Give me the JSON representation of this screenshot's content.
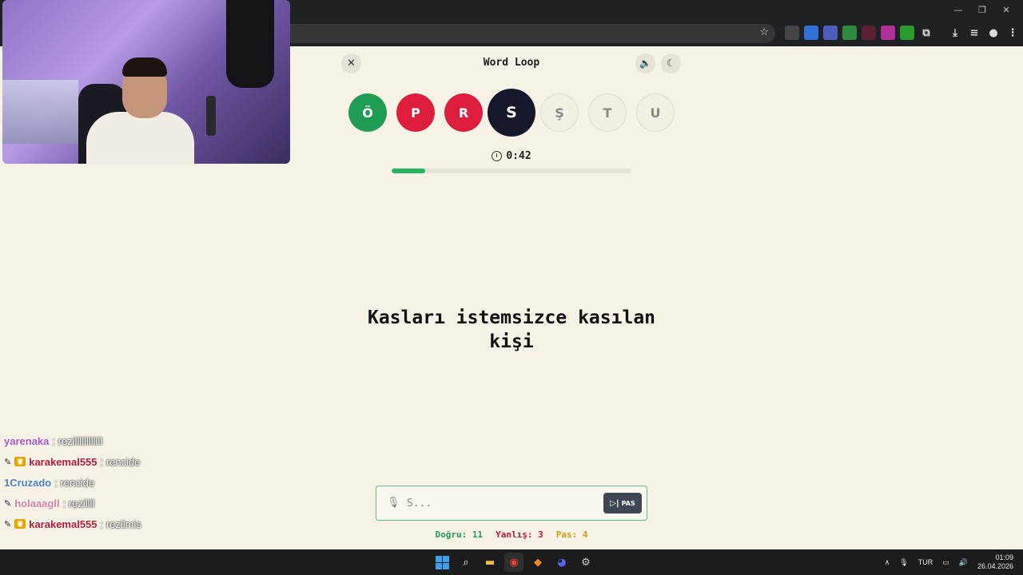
{
  "browser": {
    "window_controls": [
      "—",
      "❐",
      "✕"
    ]
  },
  "game": {
    "title": "Word Loop",
    "close_label": "✕",
    "sound_icon": "🔈",
    "theme_icon": "☾",
    "letters": [
      {
        "char": "Ö",
        "state": "correct"
      },
      {
        "char": "P",
        "state": "wrong"
      },
      {
        "char": "R",
        "state": "wrong"
      },
      {
        "char": "S",
        "state": "current"
      },
      {
        "char": "Ş",
        "state": "pending"
      },
      {
        "char": "T",
        "state": "pending"
      },
      {
        "char": "U",
        "state": "pending"
      }
    ],
    "timer": "0:42",
    "time_progress": 0.14,
    "clue_line1": "Kasları istemsizce kasılan",
    "clue_line2": "kişi",
    "answer_placeholder": "S...",
    "pass_label": "PAS",
    "stats": {
      "correct": "Doğru: 11",
      "wrong": "Yanlış: 3",
      "pass": "Pas: 4"
    }
  },
  "chat": [
    {
      "user": "yarenaka",
      "message": ": rezillllllllllll",
      "color": "#a855c8",
      "badges": []
    },
    {
      "user": "karakemal555",
      "message": ": rencide",
      "color": "#c0162f",
      "badges": [
        "pencil",
        "crown"
      ]
    },
    {
      "user": "1Cruzado",
      "message": ": rencide",
      "color": "#4a7fc0",
      "badges": []
    },
    {
      "user": "holaaagll",
      "message": ": rezillll",
      "color": "#d9809a",
      "badges": [
        "pencil"
      ]
    },
    {
      "user": "karakemal555",
      "message": ": rezilmis",
      "color": "#c0162f",
      "badges": [
        "pencil",
        "crown"
      ]
    }
  ],
  "taskbar": {
    "language": "TUR",
    "time": "01:09",
    "date": "26.04.2026"
  }
}
